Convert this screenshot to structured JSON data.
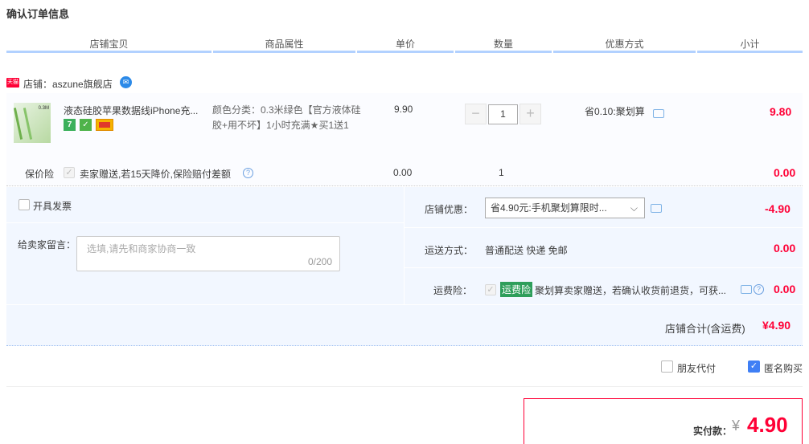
{
  "page_title": "确认订单信息",
  "columns": [
    "店铺宝贝",
    "商品属性",
    "单价",
    "数量",
    "优惠方式",
    "小计"
  ],
  "shop": {
    "tag": "天猫",
    "name": "店铺：aszune旗舰店"
  },
  "item": {
    "thumb_label": "0.3M",
    "name": "液态硅胶苹果数据线iPhone充...",
    "badges": [
      "7",
      "",
      ""
    ],
    "attr": "颜色分类：0.3米绿色【官方液体硅胶+用不坏】1小时充满★买1送1",
    "price": "9.90",
    "qty_minus": "−",
    "qty": "1",
    "qty_plus": "+",
    "discount": "省0.10:聚划算",
    "subtotal": "9.80"
  },
  "insurance": {
    "label": "保价险",
    "text": "卖家赠送,若15天降价,保险赔付差额",
    "help": "?",
    "price": "0.00",
    "qty": "1",
    "subtotal": "0.00"
  },
  "invoice_label": "开具发票",
  "message": {
    "label": "给卖家留言：",
    "placeholder": "选填,请先和商家协商一致",
    "count": "0/200"
  },
  "shop_discount": {
    "label": "店铺优惠：",
    "value": "省4.90元:手机聚划算限时...",
    "amount": "-4.90"
  },
  "shipping": {
    "label": "运送方式：",
    "value": "普通配送 快递 免邮",
    "amount": "0.00"
  },
  "shipping_insurance": {
    "label": "运费险：",
    "tag": "运费险",
    "text": "聚划算卖家赠送，若确认收货前退货，可获...",
    "amount": "0.00"
  },
  "shop_total": {
    "label": "店铺合计(含运费)",
    "amount": "¥4.90"
  },
  "options": {
    "friend_pay": "朋友代付",
    "anonymous": "匿名购买"
  },
  "final": {
    "label": "实付款：",
    "currency": "¥",
    "amount": "4.90"
  },
  "colors": {
    "accent_red": "#ff0036",
    "header_line": "#b2d1ff",
    "band_bg": "#f2f7ff",
    "check_blue": "#3f7ff5"
  }
}
